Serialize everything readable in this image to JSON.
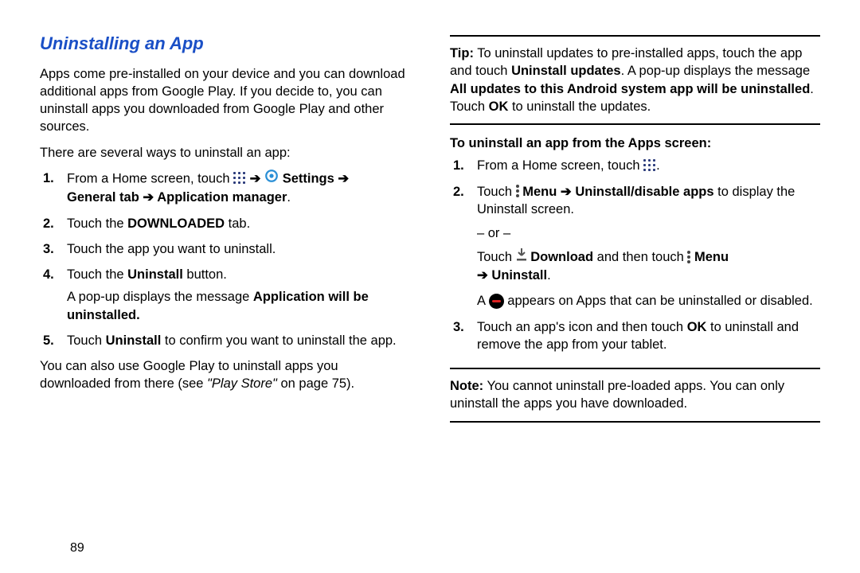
{
  "pageNumber": "89",
  "heading": "Uninstalling an App",
  "left": {
    "intro1": "Apps come pre-installed on your device and you can download additional apps from Google Play. If you decide to, you can uninstall apps you downloaded from Google Play and other sources.",
    "intro2": "There are several ways to uninstall an app:",
    "step1_a": "From a Home screen, touch ",
    "step1_settings": "Settings",
    "step1_general": "General tab",
    "step1_appmgr": "Application manager",
    "step2_a": "Touch the ",
    "step2_b": "DOWNLOADED",
    "step2_c": " tab.",
    "step3": "Touch the app you want to uninstall.",
    "step4_a": "Touch the ",
    "step4_b": "Uninstall",
    "step4_c": " button.",
    "step4_note_a": "A pop-up displays the message ",
    "step4_note_b": "Application will be uninstalled.",
    "step5_a": "Touch ",
    "step5_b": "Uninstall",
    "step5_c": " to confirm you want to uninstall the app.",
    "closing_a": "You can also use Google Play to uninstall apps you downloaded from there (see ",
    "closing_b": "\"Play Store\"",
    "closing_c": " on page 75)."
  },
  "right": {
    "tip_label": "Tip:",
    "tip_a": " To uninstall updates to pre-installed apps, touch the app and touch ",
    "tip_b": "Uninstall updates",
    "tip_c": ". A pop-up displays the message ",
    "tip_d": "All updates to this Android system app will be uninstalled",
    "tip_e": ". Touch ",
    "tip_f": "OK",
    "tip_g": " to uninstall the updates.",
    "subhead": "To uninstall an app from the Apps screen:",
    "r1": "From a Home screen, touch ",
    "r2_a": "Touch ",
    "r2_menu": "Menu",
    "r2_b": "Uninstall/disable apps",
    "r2_c": " to display the Uninstall screen.",
    "or": "– or –",
    "r2_d": "Touch ",
    "r2_download": "Download",
    "r2_e": " and then touch ",
    "r2_uninstall": "Uninstall",
    "r2_badge_a": "A ",
    "r2_badge_b": " appears on Apps that can be uninstalled or disabled.",
    "r3_a": "Touch an app's icon and then touch ",
    "r3_b": "OK",
    "r3_c": " to uninstall and remove the app from your tablet.",
    "note_label": "Note:",
    "note_body": " You cannot uninstall pre-loaded apps. You can only uninstall the apps you have downloaded."
  }
}
